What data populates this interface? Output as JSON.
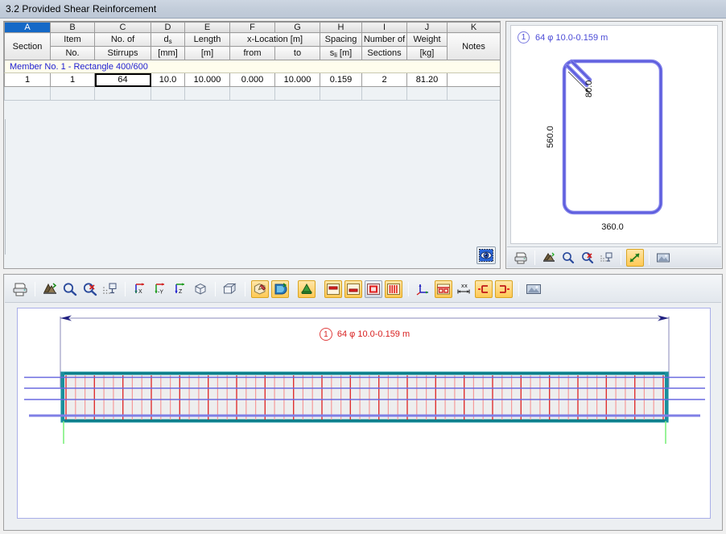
{
  "window": {
    "title": "3.2  Provided Shear Reinforcement"
  },
  "table": {
    "column_letters": [
      "A",
      "B",
      "C",
      "D",
      "E",
      "F",
      "G",
      "H",
      "I",
      "J",
      "K"
    ],
    "selected_column_letter": "A",
    "headers": [
      {
        "letter": "A",
        "line1": "Section",
        "line2": ""
      },
      {
        "letter": "B",
        "line1": "Item",
        "line2": "No."
      },
      {
        "letter": "C",
        "line1": "No. of",
        "line2": "Stirrups"
      },
      {
        "letter": "D",
        "line1": "ds",
        "line2": "[mm]"
      },
      {
        "letter": "E",
        "line1": "Length",
        "line2": "[m]"
      },
      {
        "letter": "F",
        "line1": "x-Location [m]",
        "line2": "from"
      },
      {
        "letter": "G",
        "line1": "",
        "line2": "to"
      },
      {
        "letter": "H",
        "line1": "Spacing",
        "line2": "sli [m]"
      },
      {
        "letter": "I",
        "line1": "Number of",
        "line2": "Sections"
      },
      {
        "letter": "J",
        "line1": "Weight",
        "line2": "[kg]"
      },
      {
        "letter": "K",
        "line1": "",
        "line2": "Notes"
      }
    ],
    "header_parts": {
      "ds_base": "d",
      "ds_sub": "s",
      "sli_base": "s",
      "sli_sub": "li",
      "sli_unit": " [m]",
      "xloc": "x-Location [m]"
    },
    "group_row": "Member No. 1  -  Rectangle 400/600",
    "rows": [
      {
        "section": "1",
        "item_no": "1",
        "no_of_stirrups": "64",
        "ds": "10.0",
        "length": "10.000",
        "x_from": "0.000",
        "x_to": "10.000",
        "spacing": "0.159",
        "number_of_sections": "2",
        "weight": "81.20",
        "notes": ""
      }
    ],
    "selected_cell": "no_of_stirrups",
    "view_button_icon": "eye-icon"
  },
  "section_view": {
    "label_number": "1",
    "label_text": "64 φ 10.0-0.159 m",
    "dim_height": "560.0",
    "dim_width": "360.0",
    "dim_hook": "80.0",
    "stirrup_color": "#7b7be8",
    "toolbar": [
      {
        "name": "print-icon",
        "state": "normal"
      },
      {
        "name": "separator",
        "state": "sep"
      },
      {
        "name": "render-icon",
        "state": "normal"
      },
      {
        "name": "zoom-in-icon",
        "state": "normal"
      },
      {
        "name": "zoom-reset-icon",
        "state": "normal"
      },
      {
        "name": "grid-snap-icon",
        "state": "normal"
      },
      {
        "name": "separator",
        "state": "sep"
      },
      {
        "name": "resize-arrow-icon",
        "state": "active"
      },
      {
        "name": "separator",
        "state": "sep"
      },
      {
        "name": "picture-icon",
        "state": "normal"
      }
    ]
  },
  "member_view": {
    "label_number": "1",
    "label_text": "64 φ 10.0-0.159 m",
    "beam_outline_color": "#0e8090",
    "longitudinal_color": "#6a6ae0",
    "stirrup_color": "#e03030",
    "toolbar": [
      {
        "name": "print-icon",
        "state": "normal"
      },
      {
        "name": "separator",
        "state": "sep"
      },
      {
        "name": "render-icon",
        "state": "normal"
      },
      {
        "name": "zoom-in-icon",
        "state": "normal"
      },
      {
        "name": "zoom-reset-icon",
        "state": "normal"
      },
      {
        "name": "grid-snap-icon",
        "state": "normal"
      },
      {
        "name": "separator",
        "state": "sep"
      },
      {
        "name": "view-x-icon",
        "state": "normal",
        "label": "X"
      },
      {
        "name": "view-negy-icon",
        "state": "normal",
        "label": "-Y"
      },
      {
        "name": "view-z-icon",
        "state": "normal",
        "label": "Z"
      },
      {
        "name": "view-iso-icon",
        "state": "normal"
      },
      {
        "name": "separator",
        "state": "sep"
      },
      {
        "name": "perspective-icon",
        "state": "normal"
      },
      {
        "name": "separator",
        "state": "sep"
      },
      {
        "name": "edit-solid-icon",
        "state": "active"
      },
      {
        "name": "shade-icon",
        "state": "active"
      },
      {
        "name": "gap",
        "state": "gap"
      },
      {
        "name": "lighting-icon",
        "state": "active"
      },
      {
        "name": "gap",
        "state": "gap"
      },
      {
        "name": "section-top-icon",
        "state": "active"
      },
      {
        "name": "section-bottom-icon",
        "state": "active"
      },
      {
        "name": "section-center-icon",
        "state": "activeb"
      },
      {
        "name": "stirrups-icon",
        "state": "active"
      },
      {
        "name": "separator",
        "state": "sep"
      },
      {
        "name": "axes-icon",
        "state": "normal"
      },
      {
        "name": "table-view-icon",
        "state": "active"
      },
      {
        "name": "dimension-icon",
        "state": "normal"
      },
      {
        "name": "left-end-icon",
        "state": "active"
      },
      {
        "name": "right-end-icon",
        "state": "active"
      },
      {
        "name": "separator",
        "state": "sep"
      },
      {
        "name": "picture-icon",
        "state": "normal"
      }
    ]
  }
}
